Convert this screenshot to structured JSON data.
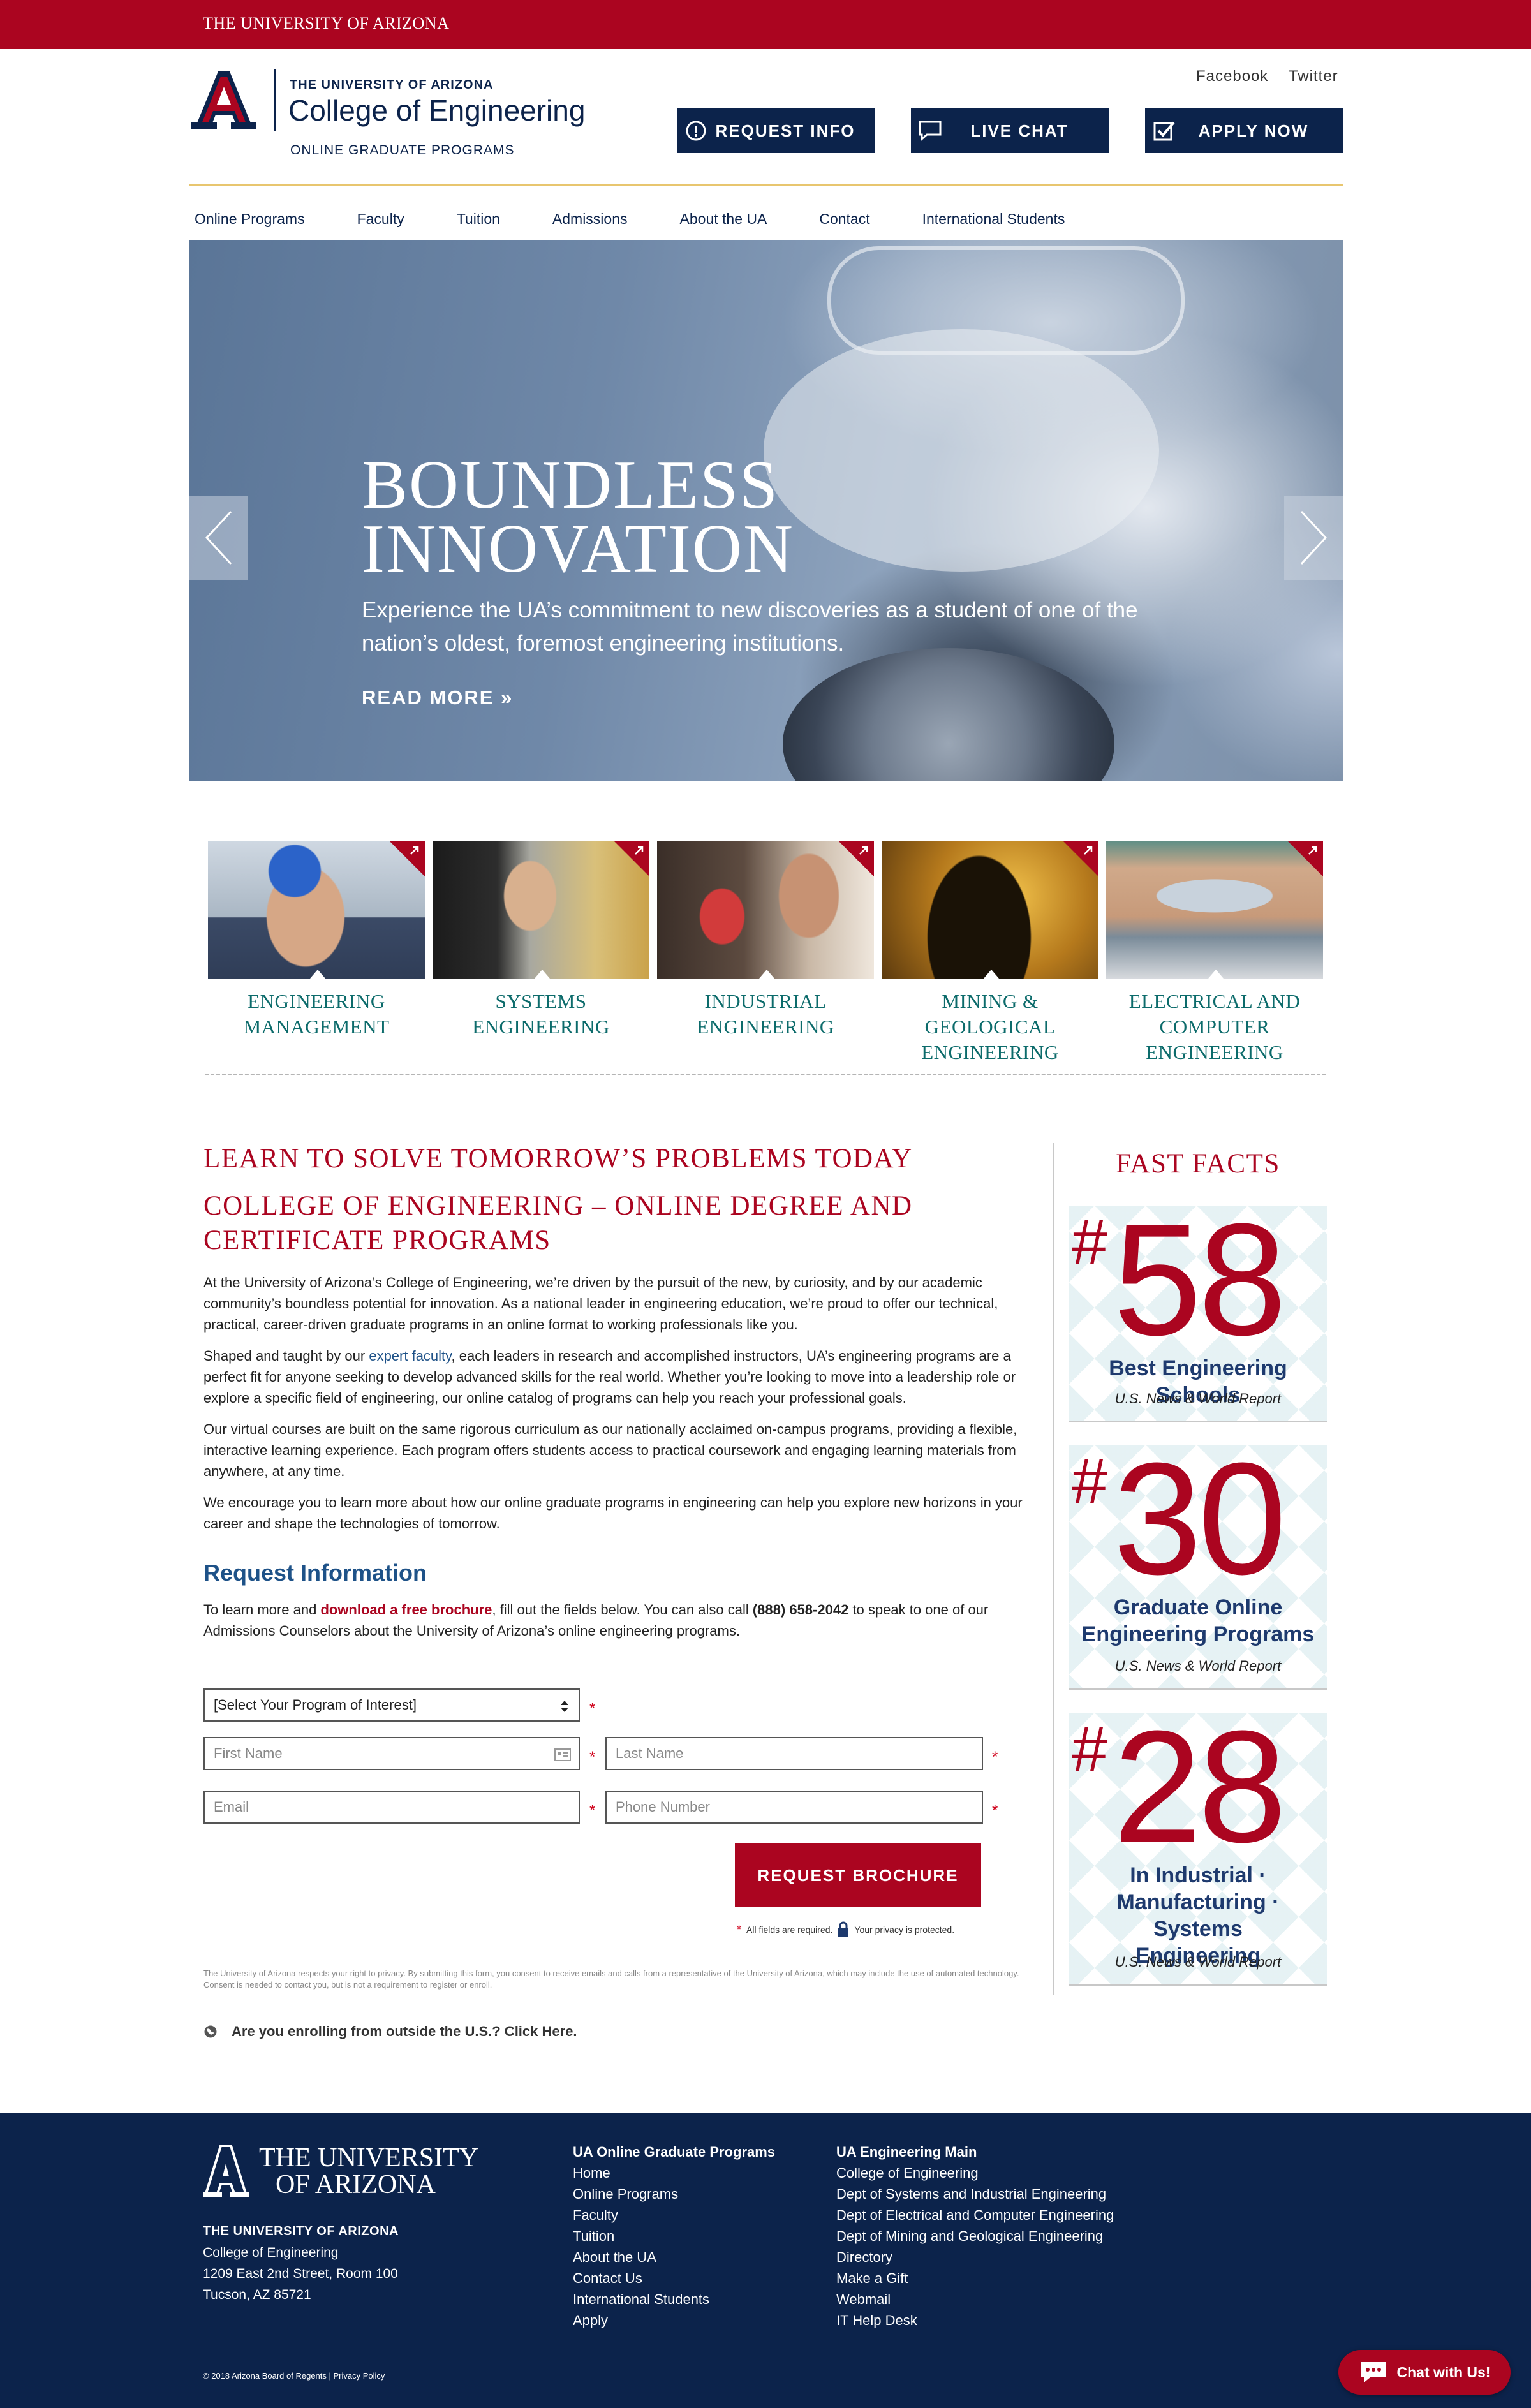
{
  "topbar": {
    "brand": "THE UNIVERSITY OF ARIZONA"
  },
  "header": {
    "logo_ua": "THE UNIVERSITY OF ARIZONA",
    "logo_college": "College of Engineering",
    "logo_subtitle": "ONLINE GRADUATE PROGRAMS",
    "social": [
      "Facebook",
      "Twitter"
    ],
    "cta": [
      {
        "label": "REQUEST INFO",
        "icon": "info-icon"
      },
      {
        "label": "LIVE CHAT",
        "icon": "chat-bubble-icon"
      },
      {
        "label": "APPLY NOW",
        "icon": "checkbox-icon"
      }
    ]
  },
  "nav": [
    "Online Programs",
    "Faculty",
    "Tuition",
    "Admissions",
    "About the UA",
    "Contact",
    "International Students"
  ],
  "hero": {
    "title_line1": "BOUNDLESS",
    "title_line2": "INNOVATION",
    "subtitle": "Experience the UA’s commitment to new discoveries as a student of one of the nation’s oldest, foremost engineering institutions.",
    "read_more": "READ MORE »"
  },
  "programs": [
    {
      "line1": "ENGINEERING",
      "line2": "MANAGEMENT",
      "line3": ""
    },
    {
      "line1": "SYSTEMS",
      "line2": "ENGINEERING",
      "line3": ""
    },
    {
      "line1": "INDUSTRIAL",
      "line2": "ENGINEERING",
      "line3": ""
    },
    {
      "line1": "MINING &",
      "line2": "GEOLOGICAL",
      "line3": "ENGINEERING"
    },
    {
      "line1": "ELECTRICAL AND",
      "line2": "COMPUTER",
      "line3": "ENGINEERING"
    }
  ],
  "main": {
    "heading1": "LEARN TO SOLVE TOMORROW’S PROBLEMS TODAY",
    "heading2_line1": "COLLEGE OF ENGINEERING – ONLINE DEGREE AND",
    "heading2_line2": "CERTIFICATE PROGRAMS",
    "para1": "At the University of Arizona’s College of Engineering, we’re driven by the pursuit of the new, by curiosity, and by our academic community’s boundless potential for innovation. As a national leader in engineering education, we’re proud to offer our technical, practical, career-driven graduate programs in an online format to working professionals like you.",
    "para2_pre": "Shaped and taught by our ",
    "para2_link": "expert faculty",
    "para2_post": ", each leaders in research and accomplished instructors, UA’s engineering programs are a perfect fit for anyone seeking to develop advanced skills for the real world. Whether you’re looking to move into a leadership role or explore a specific field of engineering, our online catalog of programs can help you reach your professional goals.",
    "para3": "Our virtual courses are built on the same rigorous curriculum as our nationally acclaimed on-campus programs, providing a flexible, interactive learning experience. Each program offers students access to practical coursework and engaging learning materials from anywhere, at any time.",
    "para4": "We encourage you to learn more about how our online graduate programs in engineering can help you explore new horizons in your career and shape the technologies of tomorrow."
  },
  "form": {
    "heading": "Request Information",
    "intro_pre": "To learn more and ",
    "intro_link": "download a free brochure",
    "intro_mid": ", fill out the fields below. You can also call ",
    "intro_phone": "(888) 658-2042",
    "intro_post": " to speak to one of our Admissions Counselors about the University of Arizona’s online engineering programs.",
    "program_select": "[Select Your Program of Interest]",
    "first_name_placeholder": "First Name",
    "last_name_placeholder": "Last Name",
    "email_placeholder": "Email",
    "phone_placeholder": "Phone Number",
    "submit_label": "REQUEST BROCHURE",
    "required_note": "All fields are required.",
    "privacy_note": "Your privacy is protected.",
    "disclaimer": "The University of Arizona respects your right to privacy. By submitting this form, you consent to receive emails and calls from a representative of the University of Arizona, which may include the use of automated technology. Consent is needed to contact you, but is not a requirement to register or enroll.",
    "international": "Are you enrolling from outside the U.S.? Click Here."
  },
  "fast_facts": {
    "title": "FAST FACTS",
    "items": [
      {
        "rank": "58",
        "label_line1": "Best Engineering Schools",
        "label_line2": "",
        "label_line3": "",
        "source": "U.S. News & World Report"
      },
      {
        "rank": "30",
        "label_line1": "Graduate Online",
        "label_line2": "Engineering Programs",
        "label_line3": "",
        "source": "U.S. News & World Report"
      },
      {
        "rank": "28",
        "label_line1": "In Industrial ·",
        "label_line2": "Manufacturing · Systems",
        "label_line3": "Engineering",
        "source": "U.S. News & World Report"
      }
    ]
  },
  "footer": {
    "logo_line1": "THE UNIVERSITY",
    "logo_line2": "OF ARIZONA",
    "addr_title": "THE UNIVERSITY OF ARIZONA",
    "addr_line1": "College of Engineering",
    "addr_line2": "1209 East 2nd Street, Room 100",
    "addr_line3": "Tucson, AZ 85721",
    "col1_heading": "UA Online Graduate Programs",
    "col1_links": [
      "Home",
      "Online Programs",
      "Faculty",
      "Tuition",
      "About the UA",
      "Contact Us",
      "International Students",
      "Apply"
    ],
    "col2_heading": "UA Engineering Main",
    "col2_links": [
      "College of Engineering",
      "Dept of Systems and Industrial Engineering",
      "Dept of Electrical and Computer Engineering",
      "Dept of Mining and Geological Engineering",
      "Directory",
      "Make a Gift",
      "Webmail",
      "IT Help Desk"
    ],
    "copyright": "© 2018 Arizona Board of Regents | Privacy Policy"
  },
  "chat_widget": {
    "label": "Chat with Us!"
  },
  "colors": {
    "brand_red": "#ab0520",
    "navy": "#0c234b",
    "gold_rule": "#e8c66f",
    "teal_label": "#0c6b6b"
  }
}
